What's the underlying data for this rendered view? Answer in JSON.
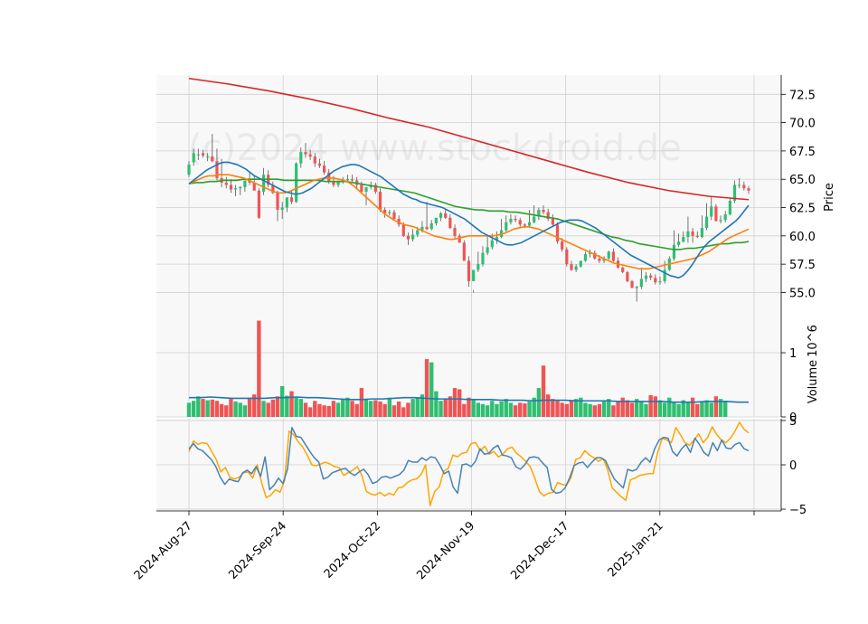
{
  "chart_data": {
    "type": "candlestick",
    "watermark": "(c)2024 www.stockdroid.de",
    "colors": {
      "up": "#2fbf71",
      "down": "#f05454",
      "ma_short": "#1f77b4",
      "ma_mid": "#ff7f0e",
      "ma_long": "#2ca02c",
      "ma_xlong": "#d62728",
      "volume_avg": "#1f77b4",
      "osc_fast": "#4682b4",
      "osc_slow": "#ffa500",
      "panel_bg": "#f8f8f8",
      "grid": "#d0d0d0"
    },
    "x_ticks": [
      "2024-Aug-27",
      "2024-Sep-24",
      "2024-Oct-22",
      "2024-Nov-19",
      "2024-Dec-17",
      "2025-Jan-21"
    ],
    "price_panel": {
      "ylabel": "Price",
      "ylim": [
        52.8,
        74.2
      ],
      "yticks": [
        "55.0",
        "57.5",
        "60.0",
        "62.5",
        "65.0",
        "67.5",
        "70.0",
        "72.5"
      ],
      "candles": {
        "open": [
          65.4,
          66.5,
          67.2,
          67.3,
          67.0,
          67.0,
          66.6,
          65.1,
          64.7,
          64.5,
          64.1,
          64.2,
          64.3,
          64.9,
          64.7,
          64.0,
          63.9,
          65.4,
          64.5,
          63.8,
          62.3,
          62.5,
          63.4,
          63.0,
          66.4,
          67.4,
          67.2,
          67.0,
          66.4,
          66.2,
          65.6,
          64.8,
          64.5,
          64.8,
          64.9,
          65.0,
          64.9,
          64.5,
          63.9,
          64.3,
          64.5,
          63.9,
          62.3,
          62.0,
          62.1,
          61.5,
          61.0,
          60.0,
          59.7,
          60.1,
          60.5,
          60.8,
          60.6,
          61.1,
          61.6,
          62.0,
          61.6,
          60.7,
          60.0,
          59.4,
          57.8,
          56.0,
          57.0,
          57.5,
          58.5,
          59.0,
          59.6,
          59.9,
          60.5,
          61.2,
          61.5,
          61.4,
          61.0,
          60.9,
          61.2,
          61.7,
          62.3,
          62.1,
          61.5,
          61.0,
          59.5,
          58.8,
          57.5,
          57.0,
          57.3,
          57.8,
          58.4,
          58.5,
          58.0,
          57.8,
          58.0,
          58.6,
          57.8,
          57.2,
          56.8,
          56.0,
          55.4,
          55.5,
          56.2,
          56.5,
          56.3,
          55.9,
          56.0,
          57.0,
          58.0,
          59.2,
          59.5,
          59.9,
          60.4,
          60.0,
          59.9,
          60.7,
          61.7,
          62.6,
          61.3,
          61.4,
          61.9,
          63.1,
          64.5,
          64.5,
          64.2
        ],
        "high": [
          66.6,
          67.7,
          67.7,
          67.6,
          67.3,
          69.0,
          67.7,
          66.8,
          65.2,
          65.0,
          64.5,
          64.4,
          64.8,
          65.7,
          65.3,
          64.2,
          66.0,
          65.8,
          64.8,
          64.0,
          63.0,
          63.2,
          64.0,
          66.5,
          67.8,
          68.2,
          67.6,
          67.3,
          66.8,
          66.6,
          65.9,
          65.3,
          64.9,
          65.2,
          65.4,
          65.4,
          65.2,
          64.8,
          64.1,
          64.8,
          64.7,
          64.2,
          62.5,
          62.3,
          62.3,
          61.8,
          61.2,
          60.3,
          60.6,
          60.8,
          61.3,
          63.0,
          61.4,
          61.5,
          62.1,
          62.4,
          61.9,
          61.0,
          60.2,
          59.6,
          58.2,
          55.2,
          58.6,
          59.1,
          60.0,
          60.2,
          60.4,
          61.5,
          61.8,
          61.9,
          61.8,
          61.6,
          61.1,
          62.3,
          62.7,
          62.5,
          62.7,
          62.4,
          61.9,
          61.2,
          59.8,
          59.0,
          57.8,
          57.5,
          57.6,
          58.6,
          58.8,
          58.7,
          58.3,
          58.2,
          58.7,
          58.9,
          58.1,
          57.3,
          56.9,
          56.1,
          55.6,
          57.2,
          56.8,
          56.7,
          56.6,
          56.4,
          57.8,
          58.2,
          60.5,
          60.2,
          60.4,
          61.7,
          60.7,
          60.4,
          61.8,
          62.9,
          63.5,
          62.8,
          61.8,
          62.2,
          63.4,
          64.9,
          65.1,
          64.8,
          64.4
        ],
        "low": [
          65.2,
          66.2,
          66.7,
          66.9,
          66.6,
          66.5,
          64.9,
          64.3,
          64.2,
          63.8,
          63.5,
          63.6,
          63.9,
          64.5,
          64.0,
          61.5,
          63.6,
          64.3,
          63.7,
          61.3,
          61.5,
          62.1,
          62.8,
          62.9,
          66.0,
          66.9,
          66.7,
          66.1,
          66.0,
          65.4,
          64.6,
          64.3,
          64.3,
          64.6,
          64.7,
          64.7,
          64.2,
          63.7,
          62.7,
          64.1,
          63.7,
          62.1,
          61.6,
          61.8,
          61.4,
          60.8,
          59.9,
          59.2,
          59.5,
          59.9,
          60.3,
          60.5,
          60.5,
          60.9,
          61.3,
          61.5,
          60.6,
          59.8,
          59.4,
          58.0,
          55.5,
          55.0,
          56.8,
          57.3,
          58.3,
          58.8,
          59.3,
          59.8,
          60.3,
          61.0,
          61.2,
          60.8,
          60.7,
          60.7,
          61.1,
          61.4,
          61.9,
          61.3,
          60.8,
          59.3,
          58.6,
          57.3,
          56.9,
          56.8,
          57.2,
          57.7,
          58.1,
          57.9,
          57.6,
          57.6,
          57.9,
          57.7,
          57.1,
          56.7,
          55.9,
          55.4,
          54.2,
          55.3,
          55.9,
          56.1,
          55.7,
          55.7,
          55.8,
          56.9,
          57.8,
          59.0,
          59.4,
          59.4,
          59.4,
          59.8,
          59.8,
          60.5,
          61.4,
          61.3,
          61.1,
          61.2,
          61.8,
          62.9,
          64.2,
          64.0,
          63.7
        ],
        "close": [
          66.3,
          67.3,
          67.2,
          67.1,
          67.0,
          66.6,
          65.1,
          64.7,
          64.5,
          64.1,
          64.2,
          64.3,
          64.9,
          64.7,
          64.0,
          61.6,
          65.4,
          64.5,
          63.8,
          62.3,
          62.5,
          63.4,
          63.0,
          66.4,
          67.4,
          67.2,
          67.0,
          66.4,
          66.2,
          65.6,
          64.8,
          64.5,
          64.8,
          64.9,
          65.0,
          64.9,
          64.5,
          63.9,
          64.3,
          64.5,
          63.9,
          62.3,
          62.0,
          62.1,
          61.5,
          61.0,
          60.0,
          59.7,
          60.1,
          60.5,
          60.8,
          60.6,
          61.1,
          61.6,
          62.0,
          61.6,
          60.7,
          60.0,
          59.4,
          57.8,
          56.0,
          57.0,
          57.5,
          58.5,
          59.0,
          59.6,
          59.9,
          60.5,
          61.2,
          61.5,
          61.4,
          61.0,
          60.9,
          61.2,
          61.7,
          62.3,
          62.1,
          61.5,
          61.0,
          59.5,
          58.8,
          57.5,
          57.0,
          57.3,
          57.8,
          58.4,
          58.5,
          58.0,
          57.8,
          58.0,
          58.6,
          57.8,
          57.2,
          56.8,
          56.0,
          55.4,
          55.5,
          56.2,
          56.5,
          56.3,
          55.9,
          56.0,
          57.0,
          58.0,
          59.2,
          59.5,
          59.9,
          60.4,
          60.0,
          59.9,
          60.7,
          61.7,
          62.6,
          61.3,
          61.4,
          61.9,
          63.1,
          64.5,
          64.5,
          64.2,
          64.0
        ]
      },
      "ma_short": [
        64.6,
        64.9,
        65.2,
        65.5,
        65.8,
        66.0,
        66.2,
        66.4,
        66.5,
        66.5,
        66.4,
        66.3,
        66.1,
        65.9,
        65.6,
        65.3,
        65.1,
        64.9,
        64.7,
        64.5,
        64.3,
        64.1,
        63.9,
        63.8,
        63.7,
        63.7,
        63.8,
        64.0,
        64.2,
        64.5,
        64.8,
        65.1,
        65.4,
        65.7,
        65.9,
        66.1,
        66.2,
        66.3,
        66.3,
        66.2,
        66.0,
        65.8,
        65.6,
        65.4,
        65.2,
        64.9,
        64.6,
        64.3,
        64.0,
        63.7,
        63.5,
        63.3,
        63.2,
        63.0,
        62.9,
        62.8,
        62.7,
        62.6,
        62.5,
        62.3,
        62.1,
        61.9,
        61.7,
        61.5,
        61.2,
        60.9,
        60.6,
        60.3,
        60.1,
        59.9,
        59.7,
        59.5,
        59.3,
        59.2,
        59.2,
        59.3,
        59.4,
        59.6,
        59.8,
        60.0,
        60.2,
        60.4,
        60.6,
        60.8,
        61.0,
        61.2,
        61.3,
        61.4,
        61.4,
        61.4,
        61.3,
        61.1,
        60.9,
        60.7,
        60.4,
        60.1,
        59.8,
        59.5,
        59.2,
        58.9,
        58.6,
        58.3,
        58.1,
        57.9,
        57.7,
        57.5,
        57.3,
        57.1,
        56.9,
        56.7,
        56.5,
        56.4,
        56.3,
        56.5,
        56.9,
        57.4,
        58.0,
        58.6,
        59.1,
        59.5,
        59.8,
        60.1,
        60.4,
        60.7,
        61.0,
        61.3,
        61.7,
        62.2,
        62.7
      ],
      "ma_mid": [
        64.6,
        64.8,
        65.0,
        65.2,
        65.3,
        65.3,
        65.4,
        65.4,
        65.4,
        65.3,
        65.2,
        65.1,
        64.9,
        64.7,
        64.5,
        64.3,
        64.1,
        63.9,
        63.8,
        63.8,
        63.9,
        64.1,
        64.3,
        64.5,
        64.7,
        64.9,
        65.0,
        65.1,
        65.1,
        65.1,
        65.0,
        64.9,
        64.7,
        64.4,
        64.0,
        63.6,
        63.2,
        62.8,
        62.4,
        62.0,
        61.7,
        61.4,
        61.2,
        61.0,
        60.9,
        60.8,
        60.6,
        60.4,
        60.2,
        60.0,
        59.9,
        59.8,
        59.7,
        59.7,
        59.8,
        59.9,
        60.0,
        60.0,
        60.0,
        60.0,
        60.0,
        60.0,
        60.1,
        60.2,
        60.4,
        60.6,
        60.7,
        60.8,
        60.8,
        60.7,
        60.6,
        60.4,
        60.2,
        60.0,
        59.8,
        59.6,
        59.4,
        59.2,
        59.0,
        58.8,
        58.6,
        58.4,
        58.2,
        58.0,
        57.8,
        57.6,
        57.5,
        57.4,
        57.3,
        57.2,
        57.1,
        57.1,
        57.1,
        57.2,
        57.3,
        57.4,
        57.5,
        57.6,
        57.7,
        57.8,
        57.9,
        58.0,
        58.2,
        58.4,
        58.6,
        58.9,
        59.2,
        59.5,
        59.8,
        60.0,
        60.2,
        60.4,
        60.6
      ],
      "ma_long": [
        64.6,
        64.7,
        64.7,
        64.8,
        64.8,
        64.9,
        64.9,
        64.9,
        65.0,
        65.0,
        65.0,
        65.0,
        65.0,
        65.0,
        64.9,
        64.9,
        64.9,
        64.9,
        64.9,
        64.9,
        64.8,
        64.8,
        64.8,
        64.8,
        64.7,
        64.6,
        64.5,
        64.4,
        64.3,
        64.2,
        64.1,
        64.0,
        63.9,
        63.8,
        63.6,
        63.4,
        63.2,
        63.0,
        62.8,
        62.6,
        62.5,
        62.4,
        62.3,
        62.3,
        62.2,
        62.2,
        62.2,
        62.1,
        62.1,
        62.0,
        61.9,
        61.8,
        61.7,
        61.6,
        61.5,
        61.3,
        61.1,
        60.9,
        60.7,
        60.5,
        60.3,
        60.1,
        59.9,
        59.8,
        59.6,
        59.5,
        59.3,
        59.2,
        59.1,
        59.0,
        58.9,
        58.8,
        58.8,
        58.9,
        58.9,
        59.0,
        59.1,
        59.2,
        59.3,
        59.3,
        59.4,
        59.4,
        59.5
      ],
      "ma_xlong": [
        73.9,
        73.4,
        72.8,
        72.1,
        71.3,
        70.4,
        69.6,
        68.6,
        67.6,
        66.6,
        65.6,
        64.7,
        64.0,
        63.5,
        63.2
      ]
    },
    "volume_panel": {
      "ylabel": "Volume",
      "ylabel_exponent": "10^6",
      "ylim": [
        0,
        1.55
      ],
      "yticks": [
        "0",
        "1"
      ],
      "values": [
        0.22,
        0.25,
        0.32,
        0.28,
        0.26,
        0.27,
        0.25,
        0.2,
        0.18,
        0.28,
        0.24,
        0.22,
        0.18,
        0.3,
        0.35,
        1.5,
        0.25,
        0.22,
        0.27,
        0.32,
        0.48,
        0.33,
        0.4,
        0.3,
        0.28,
        0.22,
        0.15,
        0.25,
        0.2,
        0.18,
        0.17,
        0.25,
        0.22,
        0.28,
        0.3,
        0.25,
        0.2,
        0.45,
        0.28,
        0.25,
        0.26,
        0.24,
        0.2,
        0.3,
        0.18,
        0.24,
        0.15,
        0.22,
        0.28,
        0.3,
        0.35,
        0.9,
        0.85,
        0.4,
        0.25,
        0.28,
        0.32,
        0.45,
        0.43,
        0.2,
        0.3,
        0.26,
        0.22,
        0.2,
        0.18,
        0.25,
        0.2,
        0.24,
        0.28,
        0.22,
        0.18,
        0.22,
        0.21,
        0.24,
        0.3,
        0.45,
        0.8,
        0.35,
        0.28,
        0.25,
        0.22,
        0.2,
        0.25,
        0.28,
        0.3,
        0.22,
        0.2,
        0.18,
        0.2,
        0.25,
        0.28,
        0.18,
        0.24,
        0.3,
        0.26,
        0.22,
        0.28,
        0.24,
        0.2,
        0.34,
        0.32,
        0.26,
        0.22,
        0.3,
        0.24,
        0.2,
        0.26,
        0.22,
        0.3,
        0.2,
        0.24,
        0.26,
        0.22,
        0.32,
        0.28,
        0.25
      ],
      "average": [
        0.3,
        0.3,
        0.31,
        0.3,
        0.29,
        0.29,
        0.29,
        0.29,
        0.3,
        0.3,
        0.31,
        0.3,
        0.3,
        0.29,
        0.28,
        0.27,
        0.27,
        0.28,
        0.28,
        0.29,
        0.3,
        0.3,
        0.29,
        0.28,
        0.28,
        0.28,
        0.27,
        0.27,
        0.27,
        0.26,
        0.26,
        0.26,
        0.25,
        0.26,
        0.26,
        0.26,
        0.25,
        0.25,
        0.25,
        0.25,
        0.24,
        0.24,
        0.24,
        0.24,
        0.24,
        0.23,
        0.23,
        0.23,
        0.24,
        0.24,
        0.24,
        0.23,
        0.23
      ]
    },
    "oscillator_panel": {
      "ylim": [
        -5.2,
        5.2
      ],
      "yticks": [
        "−5",
        "0",
        "5"
      ],
      "fast": [
        1.8,
        2.4,
        1.8,
        1.6,
        1.1,
        0.6,
        -0.2,
        -1.4,
        -2.2,
        -1.6,
        -1.8,
        -1.9,
        -0.9,
        -0.6,
        -1.0,
        -0.2,
        -1.3,
        0.9,
        -2.8,
        -2.3,
        -1.5,
        -2.1,
        -0.5,
        4.2,
        3.2,
        3.1,
        2.3,
        1.5,
        0.8,
        0.3,
        -1.6,
        -1.4,
        -0.9,
        -0.7,
        -0.5,
        -0.4,
        -0.9,
        -1.2,
        -0.8,
        -0.5,
        -1.1,
        -2.1,
        -1.9,
        -1.4,
        -1.3,
        -1.5,
        -1.3,
        -1.1,
        -0.6,
        0.5,
        0.3,
        0.3,
        0.8,
        0.5,
        0.9,
        0.8,
        0.0,
        -1.0,
        -0.7,
        -2.5,
        -3.2,
        0.0,
        0.1,
        -0.2,
        0.4,
        1.8,
        1.2,
        1.3,
        1.9,
        2.2,
        1.1,
        1.0,
        0.8,
        -0.2,
        -0.5,
        0.0,
        0.8,
        0.9,
        0.8,
        0.2,
        -0.3,
        -2.8,
        -3.2,
        -3.1,
        -2.6,
        -1.5,
        -0.1,
        0.2,
        0.3,
        -0.3,
        0.3,
        0.8,
        0.8,
        0.5,
        -0.6,
        -1.6,
        -2.1,
        -2.6,
        -0.5,
        -0.7,
        -0.5,
        0.3,
        0.8,
        0.3,
        1.8,
        2.8,
        3.1,
        3.0,
        1.5,
        1.0,
        1.8,
        2.3,
        1.4,
        3.0,
        2.3,
        1.4,
        1.0,
        2.5,
        1.6,
        2.8,
        1.9,
        1.8,
        2.3,
        2.5,
        1.8,
        1.6
      ],
      "slow": [
        1.5,
        2.7,
        2.3,
        2.5,
        2.4,
        1.5,
        0.6,
        -0.8,
        -0.3,
        -1.4,
        -1.6,
        -1.4,
        -0.9,
        -0.8,
        -1.5,
        0.0,
        -2.1,
        -3.7,
        -3.4,
        -2.8,
        -3.1,
        -1.8,
        3.8,
        3.4,
        2.6,
        2.0,
        1.1,
        0.0,
        -0.1,
        0.1,
        0.3,
        0.1,
        -0.2,
        -0.3,
        -1.2,
        -0.9,
        -0.6,
        -0.2,
        -1.2,
        -3.0,
        -3.3,
        -3.4,
        -3.1,
        -3.5,
        -3.2,
        -3.4,
        -2.6,
        -2.5,
        -2.0,
        -1.7,
        -1.6,
        -1.1,
        0.0,
        -4.6,
        -3.0,
        -2.5,
        -0.7,
        -0.4,
        1.1,
        0.9,
        1.3,
        1.4,
        2.4,
        2.5,
        1.6,
        2.1,
        1.2,
        1.5,
        0.9,
        1.2,
        1.8,
        2.0,
        1.3,
        0.9,
        0.4,
        -0.2,
        -1.5,
        -3.0,
        -3.5,
        -3.2,
        -3.1,
        -2.0,
        -2.2,
        -2.3,
        -1.4,
        0.6,
        0.8,
        1.6,
        1.1,
        0.8,
        0.4,
        0.7,
        -0.5,
        -2.6,
        -3.1,
        -3.6,
        -4.0,
        -1.7,
        -1.5,
        -1.2,
        -1.1,
        -1.0,
        -1.0,
        1.4,
        3.0,
        2.8,
        2.5,
        4.2,
        3.4,
        2.5,
        2.2,
        2.8,
        3.5,
        2.5,
        3.1,
        4.3,
        3.4,
        2.8,
        2.5,
        3.0,
        3.8,
        4.8,
        4.0,
        3.6
      ]
    }
  }
}
